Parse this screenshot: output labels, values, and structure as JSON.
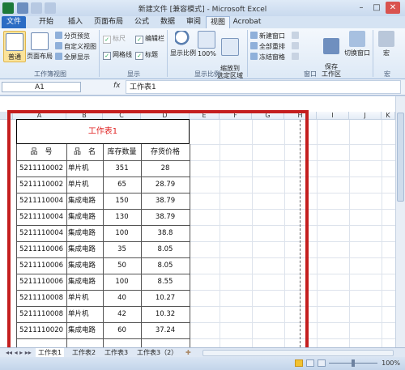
{
  "window": {
    "title": "新建文件 [兼容模式] - Microsoft Excel",
    "controls": [
      "–",
      "□",
      "✕"
    ]
  },
  "menu_tabs": [
    "文件",
    "开始",
    "插入",
    "页面布局",
    "公式",
    "数据",
    "审阅",
    "视图",
    "Acrobat"
  ],
  "ribbon": {
    "workbook_views": {
      "group_label": "工作簿视图",
      "normal": "普通",
      "page_layout": "页面布局",
      "page_break_preview": "分页预览",
      "custom_views": "自定义视图",
      "full_screen": "全屏显示"
    },
    "show": {
      "group_label": "显示",
      "ruler": "标尺",
      "formula_bar": "编辑栏",
      "gridlines": "网格线",
      "headings": "标题"
    },
    "zoom": {
      "group_label": "显示比例",
      "zoom": "显示比例",
      "hundred": "100%",
      "zoom_to_selection": "缩放到\n选定区域"
    },
    "window": {
      "group_label": "窗口",
      "new_window": "新建窗口",
      "arrange_all": "全部重排",
      "freeze_panes": "冻结窗格",
      "save_workspace": "保存\n工作区",
      "switch_windows": "切换窗口"
    },
    "macros": {
      "group_label": "宏",
      "macros": "宏"
    }
  },
  "formula_bar": {
    "name_box": "A1",
    "fx": "fx",
    "content": "工作表1"
  },
  "columns": [
    "A",
    "B",
    "C",
    "D",
    "E",
    "F",
    "G",
    "H",
    "I",
    "J",
    "K"
  ],
  "sheet_title": "工作表1",
  "table": {
    "headers": [
      "品　号",
      "品　名",
      "库存数量",
      "存货价格"
    ],
    "rows": [
      [
        "5211110002",
        "单片机",
        "351",
        "28"
      ],
      [
        "5211110002",
        "单片机",
        "65",
        "28.79"
      ],
      [
        "5211110004",
        "集成电路",
        "150",
        "38.79"
      ],
      [
        "5211110004",
        "集成电路",
        "130",
        "38.79"
      ],
      [
        "5211110004",
        "集成电路",
        "100",
        "38.8"
      ],
      [
        "5211110006",
        "集成电路",
        "35",
        "8.05"
      ],
      [
        "5211110006",
        "集成电路",
        "50",
        "8.05"
      ],
      [
        "5211110006",
        "集成电路",
        "100",
        "8.55"
      ],
      [
        "5211110008",
        "单片机",
        "40",
        "10.27"
      ],
      [
        "5211110008",
        "单片机",
        "42",
        "10.32"
      ],
      [
        "5211110020",
        "集成电路",
        "60",
        "37.24"
      ]
    ]
  },
  "sheets": [
    "工作表1",
    "工作表2",
    "工作表3",
    "工作表3（2）"
  ],
  "status": {
    "zoom_level": "100%"
  },
  "colors": {
    "title_red": "#e02020",
    "highlight_frame": "#c41e1e",
    "file_tab": "#2b6cc4"
  }
}
